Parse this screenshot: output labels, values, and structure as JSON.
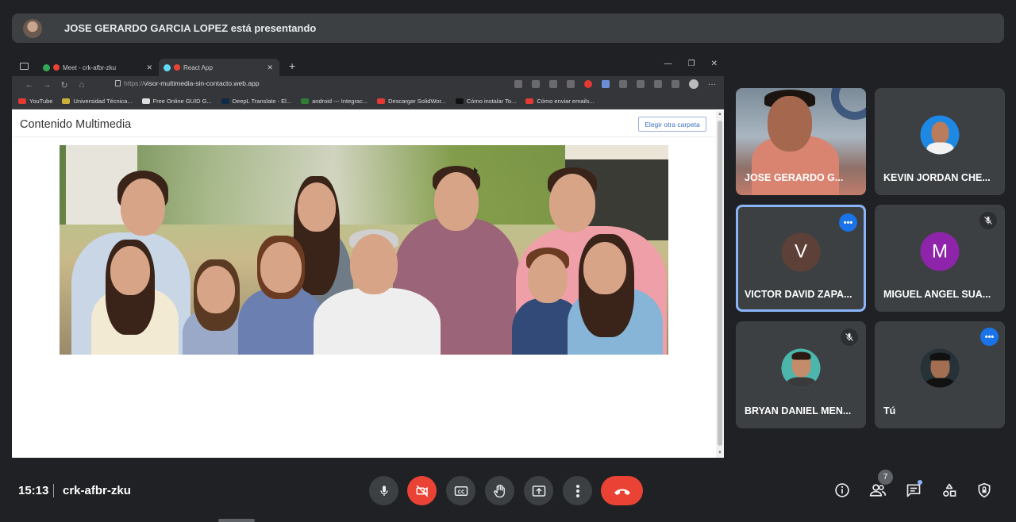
{
  "presenter_banner": {
    "text": "JOSE GERARDO GARCIA LOPEZ está presentando"
  },
  "browser": {
    "tabs": [
      {
        "label": "Meet - crk-afbr-zku"
      },
      {
        "label": "React App"
      }
    ],
    "address": {
      "protocol": "https://",
      "host": "visor-multimedia-sin-contacto.web.app"
    },
    "bookmarks": [
      {
        "label": "YouTube",
        "color": "#e53935"
      },
      {
        "label": "Universidad Técnica...",
        "color": "#c9b03a"
      },
      {
        "label": "Free Online GUID G...",
        "color": "#dddddd"
      },
      {
        "label": "DeepL Translate - El...",
        "color": "#0f2b46"
      },
      {
        "label": "android --- Integrac...",
        "color": "#2e7d32"
      },
      {
        "label": "Descargar SolidWor...",
        "color": "#e53935"
      },
      {
        "label": "Cómo instalar To...",
        "color": "#111111"
      },
      {
        "label": "Cómo enviar emails...",
        "color": "#e53935"
      }
    ]
  },
  "web_page": {
    "title": "Contenido Multimedia",
    "button_label": "Elegir otra carpeta"
  },
  "participants": [
    {
      "name": "JOSE GERARDO G...",
      "type": "video"
    },
    {
      "name": "KEVIN JORDAN CHE...",
      "type": "photo",
      "avatar_color": "#1e88e5"
    },
    {
      "name": "VICTOR DAVID ZAPA...",
      "type": "initial",
      "initial": "V",
      "avatar_color": "#5d4037",
      "speaking": true
    },
    {
      "name": "MIGUEL ANGEL SUA...",
      "type": "initial",
      "initial": "M",
      "avatar_color": "#8e24aa",
      "muted": true
    },
    {
      "name": "BRYAN DANIEL MEN...",
      "type": "photo",
      "avatar_color": "#4db6ac",
      "muted": true
    },
    {
      "name": "Tú",
      "type": "photo",
      "avatar_color": "#263238",
      "speaking": true
    }
  ],
  "bottom_bar": {
    "time": "15:13",
    "meeting_code": "crk-afbr-zku",
    "people_count": "7",
    "controls": [
      "mic",
      "camera-off",
      "captions",
      "raise-hand",
      "present",
      "more-options",
      "end-call"
    ],
    "right_actions": [
      "meeting-info",
      "people",
      "chat",
      "activities",
      "host-controls"
    ]
  }
}
